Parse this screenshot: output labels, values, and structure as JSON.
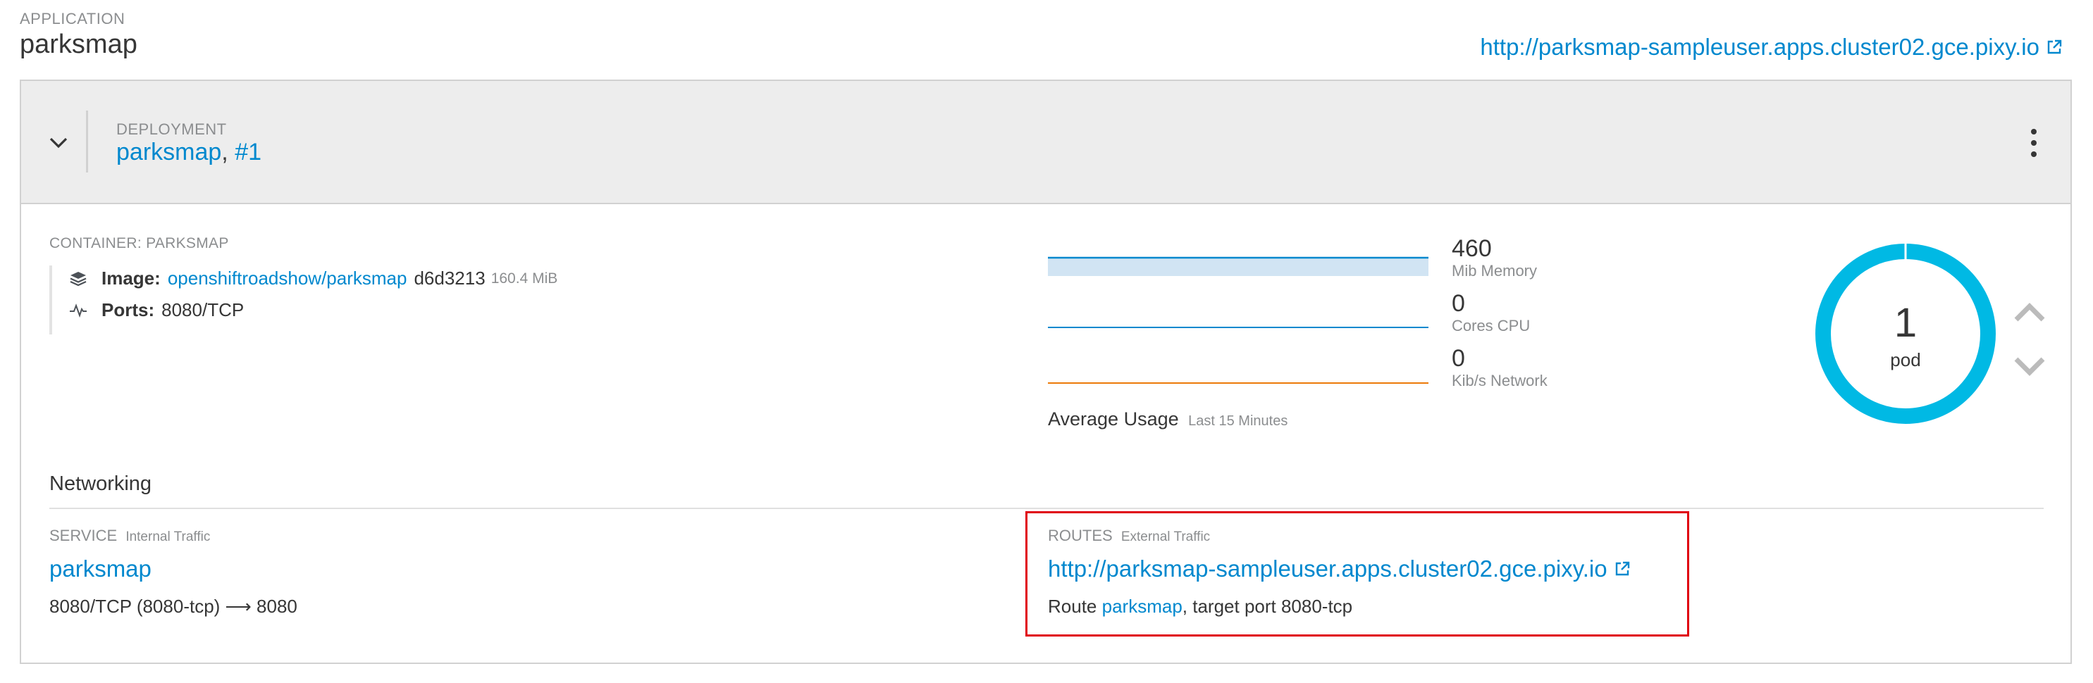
{
  "application": {
    "label": "APPLICATION",
    "name": "parksmap",
    "url": "http://parksmap-sampleuser.apps.cluster02.gce.pixy.io"
  },
  "deployment": {
    "label": "DEPLOYMENT",
    "name": "parksmap",
    "separator": ",",
    "version": "#1"
  },
  "container": {
    "label": "CONTAINER: PARKSMAP",
    "image_label": "Image:",
    "image_name": "openshiftroadshow/parksmap",
    "image_hash": "d6d3213",
    "image_size": "160.4 MiB",
    "ports_label": "Ports:",
    "ports_value": "8080/TCP",
    "icons": {
      "image": "layers-icon",
      "ports": "pulse-icon"
    }
  },
  "metrics": {
    "memory": {
      "value": "460",
      "unit": "Mib Memory",
      "color": "#0088ce"
    },
    "cpu": {
      "value": "0",
      "unit": "Cores CPU",
      "color": "#0088ce"
    },
    "network": {
      "value": "0",
      "unit": "Kib/s Network",
      "color": "#ec7a08"
    },
    "average_label": "Average Usage",
    "average_period": "Last 15 Minutes"
  },
  "pods": {
    "count": "1",
    "label": "pod",
    "ring_color": "#00b9e4"
  },
  "networking": {
    "heading": "Networking",
    "service": {
      "label": "SERVICE",
      "sublabel": "Internal Traffic",
      "name": "parksmap",
      "ports_text": "8080/TCP (8080-tcp) ⟶ 8080"
    },
    "routes": {
      "label": "ROUTES",
      "sublabel": "External Traffic",
      "url": "http://parksmap-sampleuser.apps.cluster02.gce.pixy.io",
      "prefix": "Route",
      "route_name": "parksmap",
      "suffix": ", target port 8080-tcp"
    }
  },
  "colors": {
    "link": "#0088ce",
    "highlight_box": "#e0000f",
    "header_bg": "#ededed"
  }
}
